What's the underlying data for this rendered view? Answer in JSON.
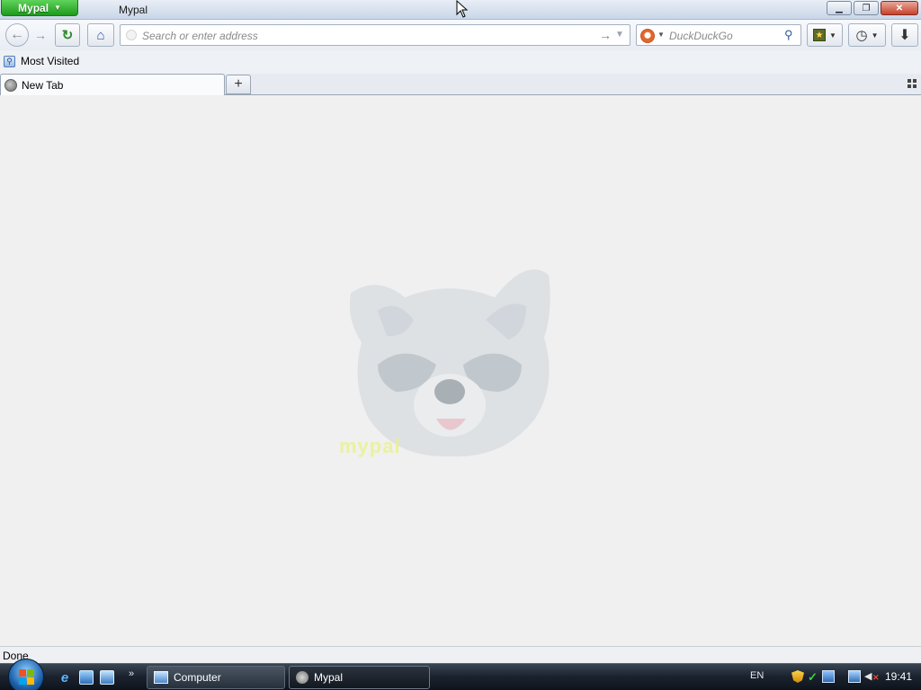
{
  "titlebar": {
    "app_menu_label": "Mypal",
    "window_title": "Mypal"
  },
  "toolbar": {
    "url_placeholder": "Search or enter address",
    "search_placeholder": "DuckDuckGo"
  },
  "bookmarks_bar": {
    "items": [
      {
        "label": "Most Visited"
      }
    ]
  },
  "tabs": [
    {
      "label": "New Tab"
    }
  ],
  "content": {
    "logo_text": "mypal"
  },
  "status": {
    "text": "Done"
  },
  "taskbar": {
    "buttons": [
      {
        "label": "Computer"
      },
      {
        "label": "Mypal"
      }
    ],
    "language": "EN",
    "clock": "19:41"
  },
  "colors": {
    "app_menu_green": "#1f9a1c",
    "content_background": "#f0f0f0",
    "taskbar_dark": "#1c2430"
  }
}
